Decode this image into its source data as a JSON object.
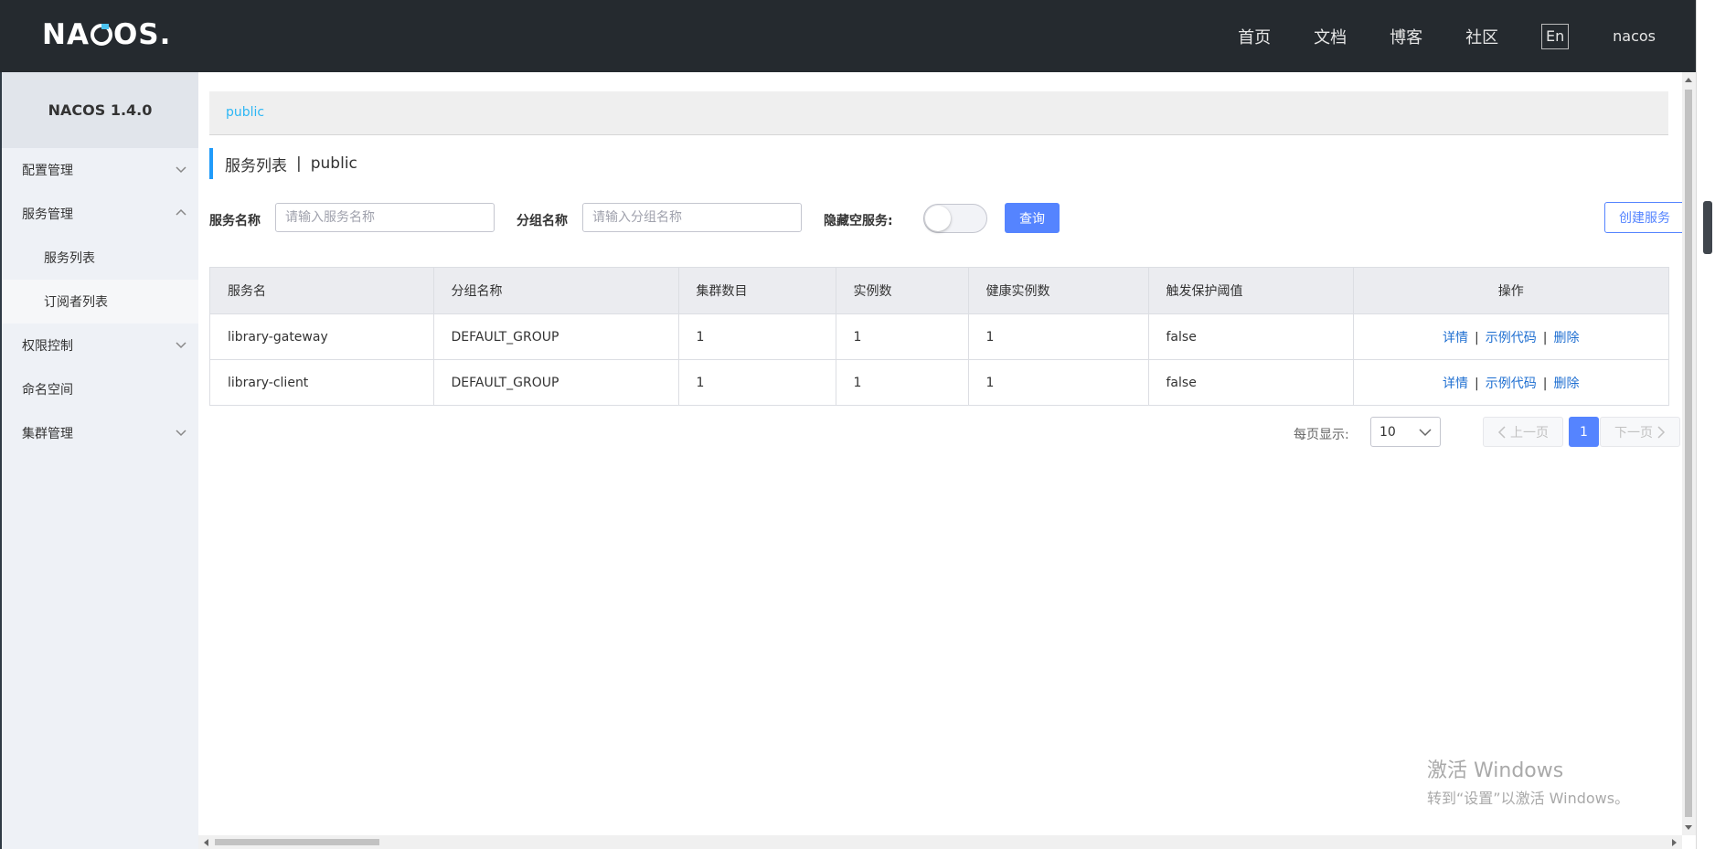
{
  "header": {
    "logo": "NACOS.",
    "nav": [
      "首页",
      "文档",
      "博客",
      "社区"
    ],
    "lang_label": "En",
    "user": "nacos"
  },
  "sidebar": {
    "version": "NACOS 1.4.0",
    "items": [
      {
        "label": "配置管理",
        "expanded": false
      },
      {
        "label": "服务管理",
        "expanded": true,
        "children": [
          {
            "label": "服务列表",
            "active": true
          },
          {
            "label": "订阅者列表",
            "active": false
          }
        ]
      },
      {
        "label": "权限控制",
        "expanded": false
      },
      {
        "label": "命名空间"
      },
      {
        "label": "集群管理",
        "expanded": false
      }
    ]
  },
  "namespace_bar": {
    "link": "public"
  },
  "page_title": {
    "main": "服务列表",
    "separator": "|",
    "namespace": "public"
  },
  "filters": {
    "service_name_label": "服务名称",
    "service_name_placeholder": "请输入服务名称",
    "group_name_label": "分组名称",
    "group_name_placeholder": "请输入分组名称",
    "hide_empty_label": "隐藏空服务:",
    "hide_empty_on": false,
    "query_button": "查询",
    "create_button": "创建服务"
  },
  "table": {
    "columns": [
      "服务名",
      "分组名称",
      "集群数目",
      "实例数",
      "健康实例数",
      "触发保护阈值",
      "操作"
    ],
    "rows": [
      {
        "cells": [
          "library-gateway",
          "DEFAULT_GROUP",
          "1",
          "1",
          "1",
          "false"
        ]
      },
      {
        "cells": [
          "library-client",
          "DEFAULT_GROUP",
          "1",
          "1",
          "1",
          "false"
        ]
      }
    ],
    "actions": [
      "详情",
      "示例代码",
      "删除"
    ],
    "action_separator": "|"
  },
  "pagination": {
    "per_page_label": "每页显示:",
    "per_page_value": "10",
    "prev_label": "上一页",
    "next_label": "下一页",
    "current_page": "1"
  },
  "watermark": {
    "line1": "激活 Windows",
    "line2": "转到“设置”以激活 Windows。"
  },
  "colors": {
    "header_bg": "#252a2f",
    "sidebar_bg": "#eef1f6",
    "primary": "#5584ff",
    "link": "#1f6fd1",
    "namespace_link": "#2db7f5",
    "title_accent": "#209bfa"
  }
}
